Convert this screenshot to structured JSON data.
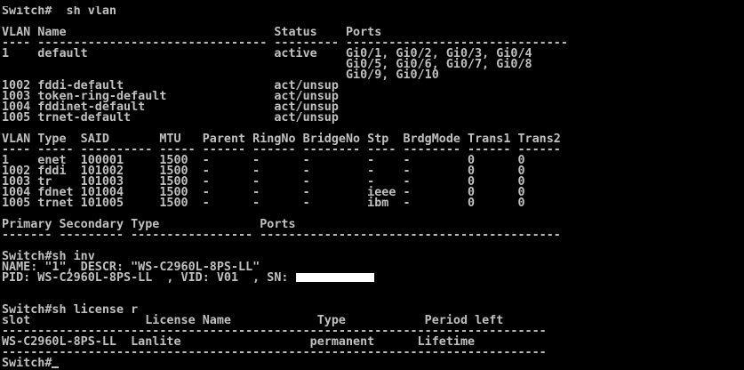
{
  "terminal": {
    "lines": [
      "Switch#  sh vlan",
      "",
      "VLAN Name                             Status    Ports",
      "---- -------------------------------- --------- -------------------------------",
      "1    default                          active    Gi0/1, Gi0/2, Gi0/3, Gi0/4",
      "                                                Gi0/5, Gi0/6, Gi0/7, Gi0/8",
      "                                                Gi0/9, Gi0/10",
      "1002 fddi-default                     act/unsup",
      "1003 token-ring-default               act/unsup",
      "1004 fddinet-default                  act/unsup",
      "1005 trnet-default                    act/unsup",
      "",
      "VLAN Type  SAID       MTU   Parent RingNo BridgeNo Stp  BrdgMode Trans1 Trans2",
      "---- ----- ---------- ----- ------ ------ -------- ---- -------- ------ ------",
      "1    enet  100001     1500  -      -      -        -    -        0      0",
      "1002 fddi  101002     1500  -      -      -        -    -        0      0",
      "1003 tr    101003     1500  -      -      -        -    -        0      0",
      "1004 fdnet 101004     1500  -      -      -        ieee -        0      0",
      "1005 trnet 101005     1500  -      -      -        ibm  -        0      0",
      "",
      "Primary Secondary Type              Ports",
      "------- --------- ----------------- ------------------------------------------",
      "",
      "Switch#sh inv",
      "NAME: \"1\", DESCR: \"WS-C2960L-8PS-LL\"",
      "PID: WS-C2960L-8PS-LL  , VID: V01  , SN: ",
      "",
      "",
      "Switch#sh license r",
      "slot                License Name            Type           Period left",
      "----------------------------------------------------------------------------",
      "WS-C2960L-8PS-LL  Lanlite                  permanent      Lifetime",
      "----------------------------------------------------------------------------",
      "Switch#"
    ]
  }
}
